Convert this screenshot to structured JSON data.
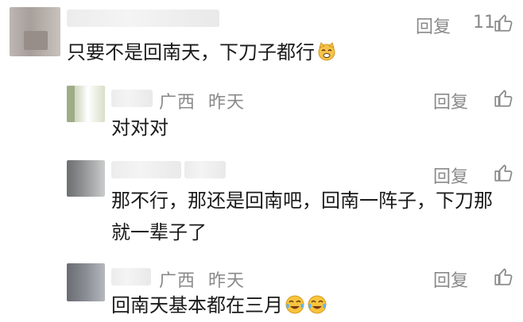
{
  "comments": [
    {
      "text": "只要不是回南天，下刀子都行",
      "reply_label": "回复",
      "like_count": "11",
      "emoji": "cat-face-emoji"
    }
  ],
  "replies": [
    {
      "location": "广西",
      "time": "昨天",
      "text": "对对对",
      "reply_label": "回复"
    },
    {
      "text_line1": "那不行，那还是回南吧，回南一阵子，下刀那",
      "text_line2": "就一辈子了",
      "reply_label": "回复"
    },
    {
      "location": "广西",
      "time": "昨天",
      "text": "回南天基本都在三月",
      "reply_label": "回复",
      "emoji": "crying-laughing-emoji"
    }
  ],
  "icons": {
    "like": "thumbs-up-icon"
  },
  "colors": {
    "meta_gray": "#8a8a8a",
    "text": "#1a1a1a"
  }
}
